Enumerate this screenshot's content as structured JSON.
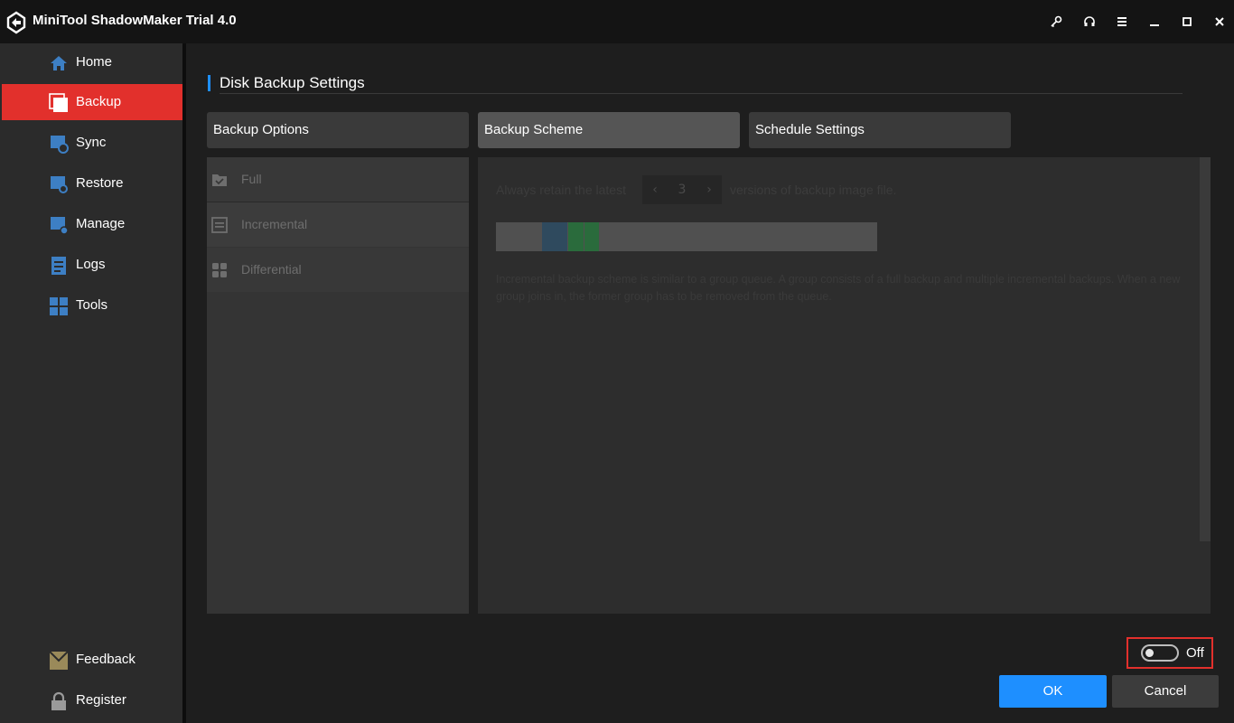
{
  "app": {
    "title": "MiniTool ShadowMaker Trial 4.0"
  },
  "window_controls": [
    "key-icon",
    "headset-icon",
    "menu-icon",
    "minimize-icon",
    "maximize-icon",
    "close-icon"
  ],
  "sidebar": {
    "items": [
      {
        "label": "Home",
        "icon": "home-icon"
      },
      {
        "label": "Backup",
        "icon": "backup-icon",
        "active": true
      },
      {
        "label": "Sync",
        "icon": "sync-icon"
      },
      {
        "label": "Restore",
        "icon": "restore-icon"
      },
      {
        "label": "Manage",
        "icon": "manage-icon"
      },
      {
        "label": "Logs",
        "icon": "logs-icon"
      },
      {
        "label": "Tools",
        "icon": "tools-icon"
      }
    ],
    "bottom": [
      {
        "label": "Feedback",
        "icon": "feedback-icon"
      },
      {
        "label": "Register",
        "icon": "lock-icon"
      }
    ]
  },
  "settings": {
    "title": "Disk Backup Settings",
    "tabs": [
      {
        "label": "Backup Options"
      },
      {
        "label": "Backup Scheme",
        "active": true
      },
      {
        "label": "Schedule Settings"
      }
    ],
    "schemes": [
      {
        "label": "Full",
        "icon": "folder-check-icon"
      },
      {
        "label": "Incremental",
        "icon": "list-icon",
        "selected": true
      },
      {
        "label": "Differential",
        "icon": "grid-icon"
      }
    ],
    "retain_prefix": "Always retain the latest",
    "retain_value": "3",
    "retain_suffix": "versions of backup image file.",
    "description_line1": "Incremental backup scheme is similar to a group queue. A group consists of a full backup and multiple incremental backups. When a new",
    "description_line2": "group joins in, the former group has to be removed from the queue.",
    "toggle_label": "Off",
    "toggle_on": false
  },
  "buttons": {
    "ok": "OK",
    "cancel": "Cancel"
  },
  "colors": {
    "accent": "#1e8fff",
    "active_nav": "#e2302c",
    "full_block": "#2f4a5e",
    "incremental_block": "#2a6b3c"
  }
}
